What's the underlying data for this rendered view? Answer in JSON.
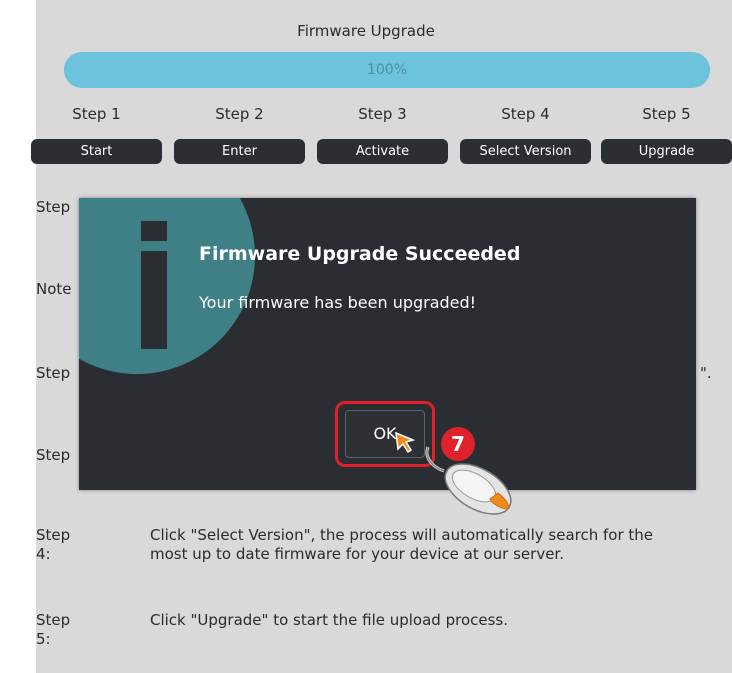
{
  "dialog_title": "Firmware Upgrade",
  "progress": {
    "percent_label": "100%",
    "fraction": 1.0
  },
  "steps": [
    {
      "label": "Step 1",
      "button": "Start"
    },
    {
      "label": "Step 2",
      "button": "Enter"
    },
    {
      "label": "Step 3",
      "button": "Activate"
    },
    {
      "label": "Step 4",
      "button": "Select Version"
    },
    {
      "label": "Step 5",
      "button": "Upgrade"
    }
  ],
  "background_fragments": {
    "step_a": "Step",
    "note": "Note",
    "step_b": "Step",
    "step_c": "Step",
    "trailing": "\"."
  },
  "instructions": [
    {
      "label": "Step 4:",
      "text": "Click \"Select Version\", the process will automatically search for the most up to date firmware for your device at our server."
    },
    {
      "label": "Step 5:",
      "text": "Click \"Upgrade\" to start the file upload process."
    }
  ],
  "modal": {
    "title": "Firmware Upgrade Succeeded",
    "message": "Your firmware has been upgraded!",
    "ok_label": "OK"
  },
  "annotation": {
    "badge": "7"
  },
  "colors": {
    "accent_progress": "#6ec3dc",
    "highlight": "#e0202a",
    "modal_bg": "#2a2e33",
    "info_circle": "#3f7f86"
  }
}
